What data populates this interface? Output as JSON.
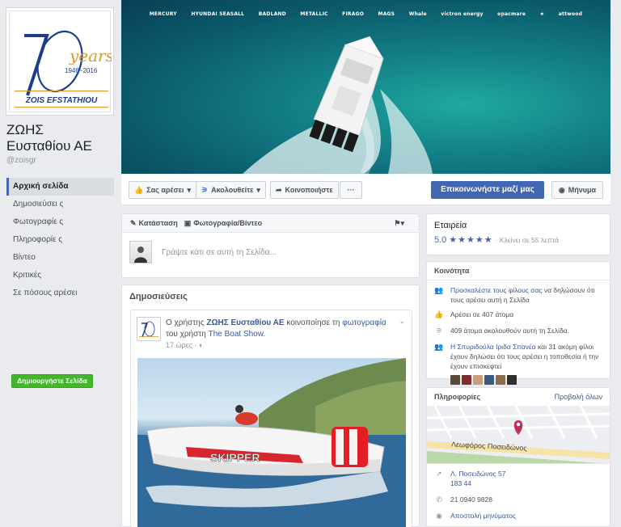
{
  "sidebar": {
    "page_name_line1": "ΖΩΗΣ",
    "page_name_line2": "Ευσταθίου ΑΕ",
    "handle": "@zoisgr",
    "logo_text_70": "70",
    "logo_years": "years",
    "logo_range": "1946~2016",
    "logo_company": "ZOIS EFSTATHIOU",
    "nav": [
      {
        "label": "Αρχική σελίδα"
      },
      {
        "label": "Δημοσιεύσει ς"
      },
      {
        "label": "Φωτογραφίε ς"
      },
      {
        "label": "Πληροφορίε ς"
      },
      {
        "label": "Βίντεο"
      },
      {
        "label": "Κριτικές"
      },
      {
        "label": "Σε πόσους αρέσει"
      }
    ],
    "create_page_label": "Δημιουργήστε Σελίδα"
  },
  "cover": {
    "brands": [
      "MERCURY",
      "HYUNDAI SEASALL",
      "BADLAND",
      "METALLIC",
      "FIRAGO",
      "MAGS",
      "Whale",
      "victron energy",
      "opacmare",
      "★",
      "attwood"
    ]
  },
  "actions": {
    "like_label": "Σας αρέσει",
    "follow_label": "Ακολουθείτε",
    "share_label": "Κοινοποιήστε",
    "more_label": "···",
    "contact_label": "Επικοινωνήστε μαζί μας",
    "message_label": "Μήνυμα"
  },
  "composer": {
    "status_label": "Κατάσταση",
    "photo_label": "Φωτογραφία/Βίντεο",
    "placeholder": "Γράψτε κάτι σε αυτή τη Σελίδα..."
  },
  "posts": {
    "title": "Δημοσιεύσεις",
    "post": {
      "prefix": "Ο χρήστης",
      "author": "ΖΩΗΣ Ευσταθίου ΑΕ",
      "mid": "κοινοποίησε τη",
      "photo_word": "φωτογραφία",
      "mid2": "του χρήστη",
      "source": "The Boat Show.",
      "time": "17 ώρες · ◐",
      "boat_text": "SKIPPER"
    }
  },
  "about": {
    "category": "Εταιρεία",
    "rating": "5.0",
    "stars": "★★★★★",
    "hours": "· Κλείνει σε 55 λεπτά"
  },
  "community": {
    "title": "Κοινότητα",
    "invite_link": "Προσκαλέστε τους φίλους σας",
    "invite_rest": "να δηλώσουν ότι τους αρέσει αυτή η Σελίδα",
    "likes": "Αρέσει σε 407 άτομα",
    "follows": "409 άτομα ακολουθούν αυτή τη Σελίδα.",
    "friend_link": "Η Σπυριδούλα Ιριδα Σπανέα",
    "friend_rest": "και 31 ακόμη φίλοι έχουν δηλώσει ότι τους αρέσει η τοποθεσία ή την έχουν επισκεφτεί",
    "thumb_colors": [
      "#5a4a3a",
      "#7b2f2f",
      "#c7a07a",
      "#3c5a7a",
      "#8a6d4a",
      "#2f2f2f"
    ]
  },
  "info": {
    "title": "Πληροφορίες",
    "see_all": "Προβολή όλων",
    "map_street": "Λεωφόρος Ποσειδώνος",
    "address_line1": "Λ. Ποσειδώνος 57",
    "address_line2": "183 44",
    "phone": "21 0940 9828",
    "send_message": "Αποστολή μηνύματος"
  }
}
